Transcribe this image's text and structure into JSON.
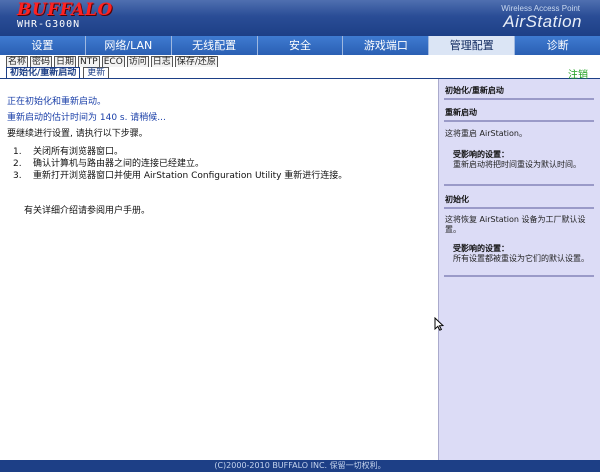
{
  "header": {
    "brand": "BUFFALO",
    "model": "WHR-G300N",
    "tagline": "Wireless Access Point",
    "product": "AirStation"
  },
  "main_nav": [
    {
      "label": "设置",
      "active": false
    },
    {
      "label": "网络/LAN",
      "active": false
    },
    {
      "label": "无线配置",
      "active": false
    },
    {
      "label": "安全",
      "active": false
    },
    {
      "label": "游戏端口",
      "active": false
    },
    {
      "label": "管理配置",
      "active": true
    },
    {
      "label": "诊断",
      "active": false
    }
  ],
  "sub_nav_row1": [
    "名称",
    "密码",
    "日期",
    "NTP",
    "ECO",
    "访问",
    "日志",
    "保存/还原"
  ],
  "sub_nav_row2": [
    {
      "label": "初始化/重新启动",
      "active": true
    },
    {
      "label": "更新",
      "active": false
    }
  ],
  "logout_label": "注销",
  "content": {
    "line1": "正在初始化和重新启动。",
    "line2": "重新启动的估计时间为 140 s. 请稍候...",
    "line3": "要继续进行设置, 请执行以下步骤。",
    "steps": [
      {
        "num": "1.",
        "text": "关闭所有浏览器窗口。"
      },
      {
        "num": "2.",
        "text": "确认计算机与路由器之间的连接已经建立。"
      },
      {
        "num": "3.",
        "text": "重新打开浏览器窗口并使用 AirStation Configuration Utility 重新进行连接。"
      }
    ],
    "note": "有关详细介绍请参阅用户手册。"
  },
  "side": {
    "title": "初始化/重新启动",
    "restart_title": "重新启动",
    "restart_desc": "这将重启 AirStation。",
    "restart_affect_title": "受影响的设置：",
    "restart_affect_text": "重新启动将把时间重设为默认时间。",
    "init_title": "初始化",
    "init_desc": "这将恢复 AirStation 设备为工厂默认设置。",
    "init_affect_title": "受影响的设置：",
    "init_affect_text": "所有设置都被重设为它们的默认设置。"
  },
  "footer": "(C)2000-2010 BUFFALO INC. 保留一切权利。",
  "colors": {
    "header_bg": "#2a4d96",
    "nav_bg": "#2c63b8",
    "side_bg": "#dcdcf6",
    "brand_red": "#ff2222",
    "logout_green": "#20a020",
    "status_blue": "#1a3fa8"
  }
}
